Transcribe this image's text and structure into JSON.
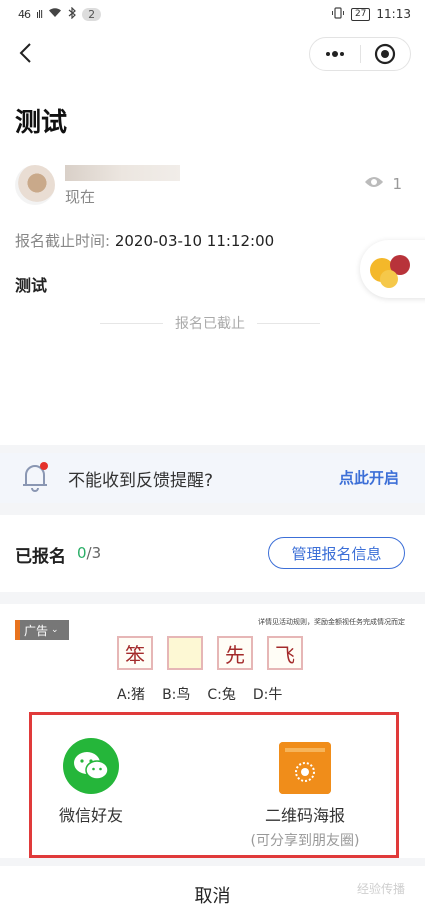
{
  "status_bar": {
    "network": "46",
    "signal": "ıll",
    "notif_count": "2",
    "battery": "27",
    "time": "11:13"
  },
  "nav": {
    "back_icon": "chevron-left-icon",
    "more_icon": "more-dots-icon",
    "close_icon": "target-circle-icon"
  },
  "event": {
    "title": "测试",
    "author_time": "现在",
    "views": "1",
    "deadline_label": "报名截止时间:",
    "deadline_value": "2020-03-10 11:12:00",
    "description": "测试",
    "status": "报名已截止"
  },
  "notice": {
    "text": "不能收到反馈提醒?",
    "link": "点此开启"
  },
  "signup": {
    "title": "已报名",
    "count": "0",
    "total": "/3",
    "manage_button": "管理报名信息"
  },
  "ad": {
    "badge": "广告",
    "description": "详情见活动规则，奖励金额视任务完成情况而定",
    "chars": [
      "笨",
      "",
      "先",
      "飞"
    ],
    "options": [
      "A:猪",
      "B:鸟",
      "C:兔",
      "D:牛"
    ]
  },
  "share": {
    "wechat_label": "微信好友",
    "poster_label": "二维码海报",
    "poster_sub": "(可分享到朋友圈)",
    "cancel": "取消",
    "watermark": "经验传播"
  },
  "colors": {
    "accent_blue": "#3c6fd7",
    "wechat_green": "#25b63a",
    "poster_orange": "#f08d1a",
    "highlight_red": "#e03a3a",
    "count_green": "#2aae67"
  }
}
